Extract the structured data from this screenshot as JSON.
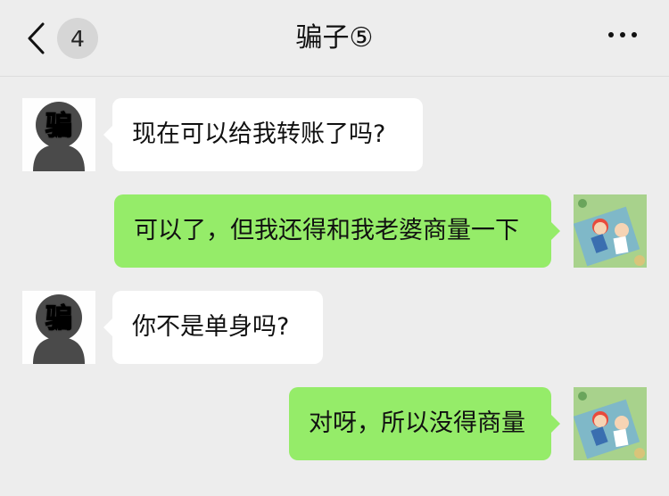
{
  "header": {
    "back_icon": "chevron-left-icon",
    "unread_count": "4",
    "title": "骗子⑤",
    "more_icon": "more-dots-icon"
  },
  "contact_avatar": {
    "char": "骗"
  },
  "messages": [
    {
      "sender": "contact",
      "text": "现在可以给我转账了吗?"
    },
    {
      "sender": "me",
      "text": "可以了，但我还得和我老婆商量一下"
    },
    {
      "sender": "contact",
      "text": "你不是单身吗?"
    },
    {
      "sender": "me",
      "text": "对呀，所以没得商量"
    }
  ],
  "colors": {
    "background": "#ededed",
    "incoming_bubble": "#ffffff",
    "outgoing_bubble": "#95ec69"
  }
}
